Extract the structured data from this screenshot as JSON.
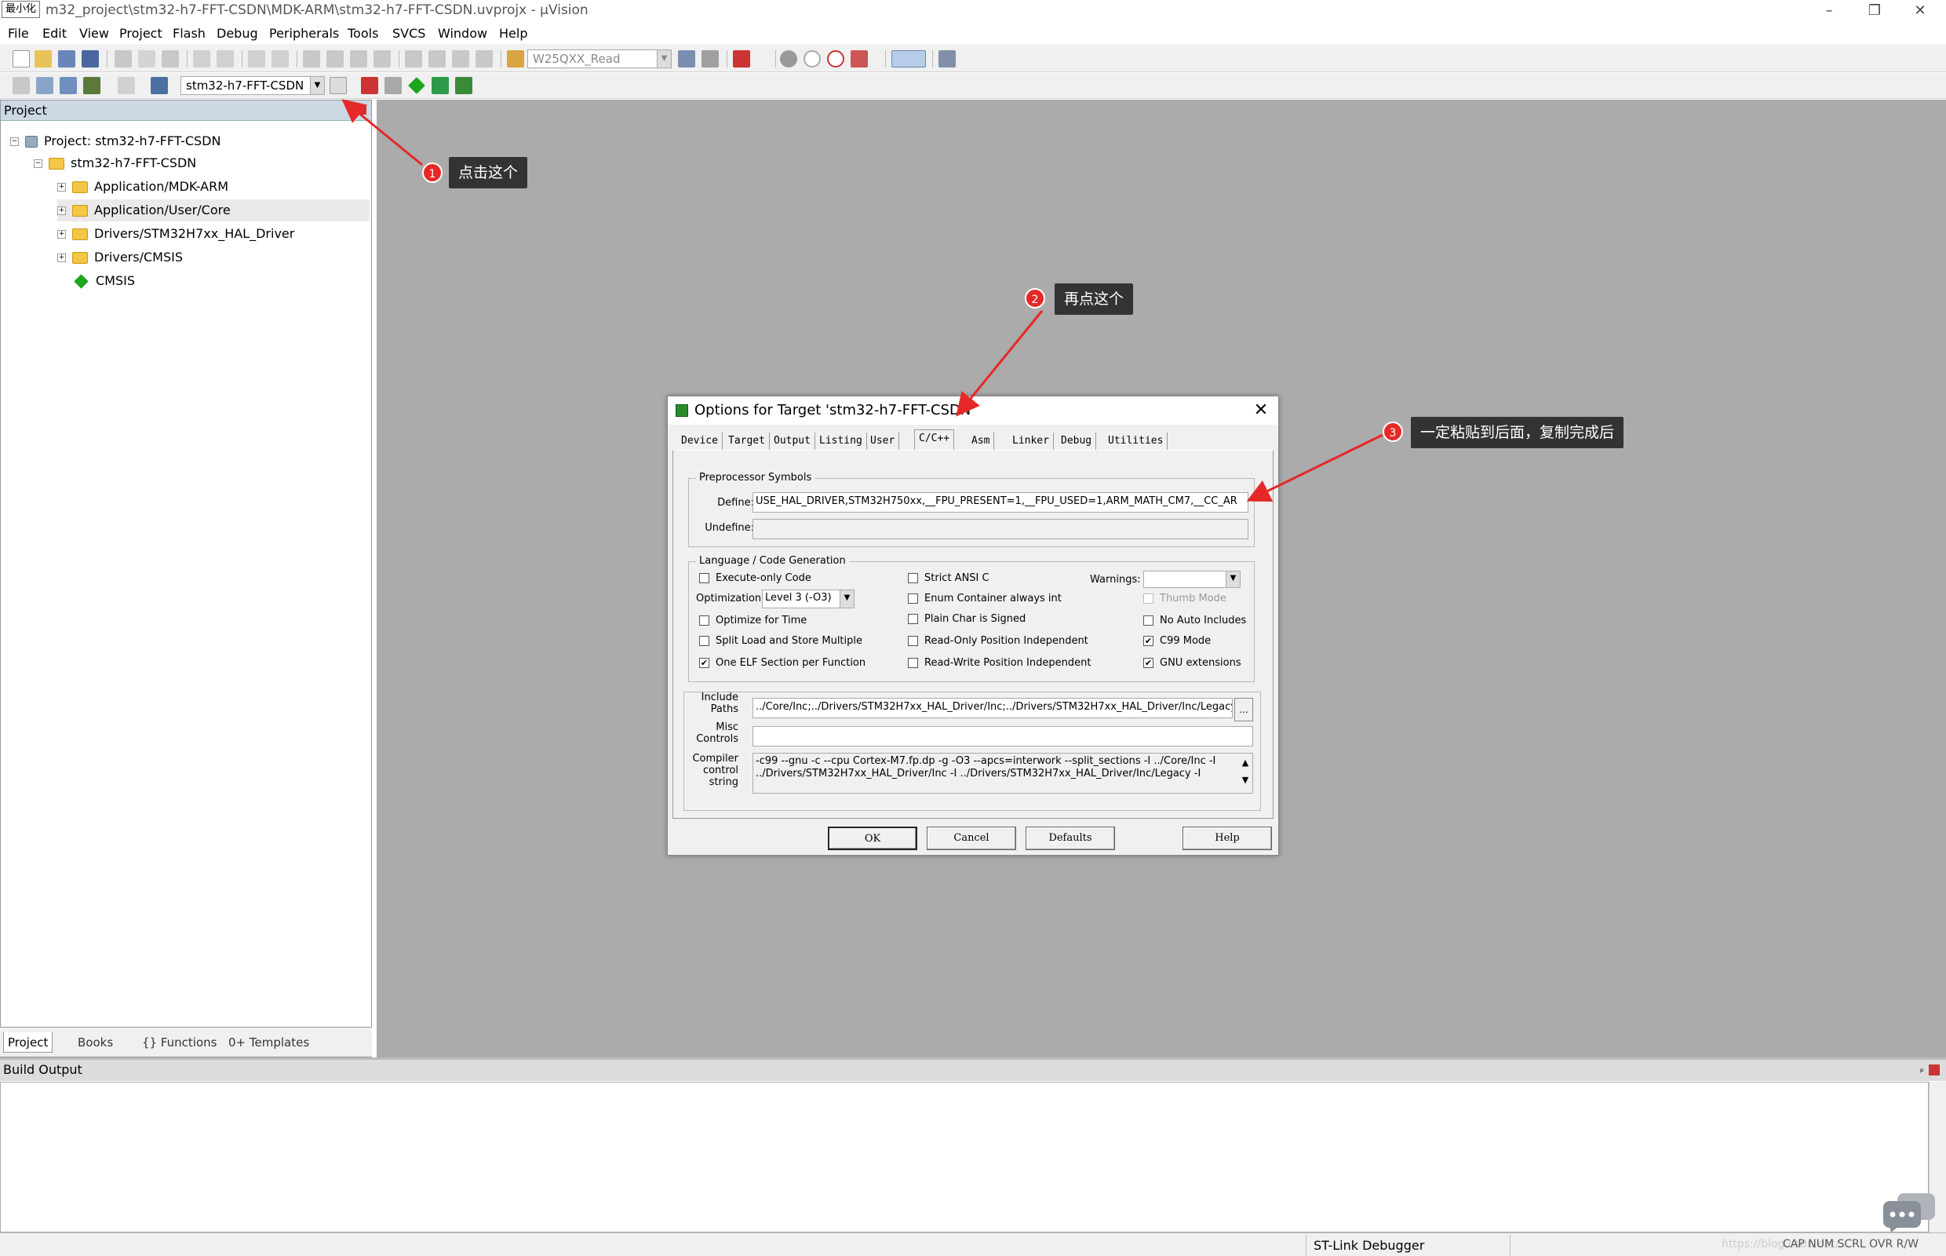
{
  "window": {
    "minimize_tooltip": "最小化",
    "title": "m32_project\\stm32-h7-FFT-CSDN\\MDK-ARM\\stm32-h7-FFT-CSDN.uvprojx - µVision",
    "controls": [
      "–",
      "❐",
      "✕"
    ]
  },
  "menu": [
    "File",
    "Edit",
    "View",
    "Project",
    "Flash",
    "Debug",
    "Peripherals",
    "Tools",
    "SVCS",
    "Window",
    "Help"
  ],
  "toolbar": {
    "find_combo": "W25QXX_Read",
    "target_combo": "stm32-h7-FFT-CSDN"
  },
  "project_panel": {
    "header": "Project",
    "pin": "ᵖ",
    "tree": [
      {
        "label": "Project: stm32-h7-FFT-CSDN",
        "kind": "root"
      },
      {
        "label": "stm32-h7-FFT-CSDN",
        "kind": "target"
      },
      {
        "label": "Application/MDK-ARM",
        "kind": "folder"
      },
      {
        "label": "Application/User/Core",
        "kind": "folder"
      },
      {
        "label": "Drivers/STM32H7xx_HAL_Driver",
        "kind": "folder"
      },
      {
        "label": "Drivers/CMSIS",
        "kind": "folder"
      },
      {
        "label": "CMSIS",
        "kind": "component"
      }
    ],
    "tabs": [
      "Project",
      "Books",
      "{} Functions",
      "0+ Templates"
    ]
  },
  "dialog": {
    "title": "Options for Target 'stm32-h7-FFT-CSDN'",
    "tabs": [
      "Device",
      "Target",
      "Output",
      "Listing",
      "User",
      "C/C++",
      "Asm",
      "Linker",
      "Debug",
      "Utilities"
    ],
    "active_tab": "C/C++",
    "preprocessor": {
      "group_label": "Preprocessor Symbols",
      "define_label": "Define:",
      "define_value": "USE_HAL_DRIVER,STM32H750xx,__FPU_PRESENT=1,__FPU_USED=1,ARM_MATH_CM7,__CC_AR",
      "undefine_label": "Undefine:",
      "undefine_value": ""
    },
    "language": {
      "group_label": "Language / Code Generation",
      "col1": [
        {
          "label": "Execute-only Code",
          "checked": false
        },
        {
          "label": "Optimize for Time",
          "checked": false
        },
        {
          "label": "Split Load and Store Multiple",
          "checked": false
        },
        {
          "label": "One ELF Section per Function",
          "checked": true
        }
      ],
      "optimization_label": "Optimization:",
      "optimization_value": "Level 3 (-O3)",
      "col2": [
        {
          "label": "Strict ANSI C",
          "checked": false
        },
        {
          "label": "Enum Container always int",
          "checked": false
        },
        {
          "label": "Plain Char is Signed",
          "checked": false
        },
        {
          "label": "Read-Only Position Independent",
          "checked": false
        },
        {
          "label": "Read-Write Position Independent",
          "checked": false
        }
      ],
      "warnings_label": "Warnings:",
      "warnings_value": "",
      "col3": [
        {
          "label": "Thumb Mode",
          "checked": false,
          "disabled": true
        },
        {
          "label": "No Auto Includes",
          "checked": false,
          "disabled": false
        },
        {
          "label": "C99 Mode",
          "checked": true,
          "disabled": false
        },
        {
          "label": "GNU extensions",
          "checked": true,
          "disabled": false
        }
      ]
    },
    "include_label_1": "Include",
    "include_label_2": "Paths",
    "include_value": "../Core/Inc;../Drivers/STM32H7xx_HAL_Driver/Inc;../Drivers/STM32H7xx_HAL_Driver/Inc/Legacy",
    "browse": "...",
    "misc_label_1": "Misc",
    "misc_label_2": "Controls",
    "misc_value": "",
    "compiler_label_1": "Compiler",
    "compiler_label_2": "control",
    "compiler_label_3": "string",
    "compiler_line_1": "-c99 --gnu -c --cpu Cortex-M7.fp.dp -g -O3 --apcs=interwork --split_sections -I ../Core/Inc -I",
    "compiler_line_2": "../Drivers/STM32H7xx_HAL_Driver/Inc -I ../Drivers/STM32H7xx_HAL_Driver/Inc/Legacy -I",
    "buttons": {
      "ok": "OK",
      "cancel": "Cancel",
      "defaults": "Defaults",
      "help": "Help"
    }
  },
  "annotations": [
    {
      "num": "1",
      "text": "点击这个"
    },
    {
      "num": "2",
      "text": "再点这个"
    },
    {
      "num": "3",
      "text": "一定粘贴到后面，复制完成后"
    }
  ],
  "build_output": {
    "header": "Build Output"
  },
  "statusbar": {
    "debugger": "ST-Link Debugger",
    "watermark": "https://blog.csdn.net/...",
    "indicators": "CAP  NUM  SCRL  OVR  R/W"
  },
  "colors": {
    "workspace": "#ababab",
    "callout_bg": "#333333",
    "badge": "#e62828",
    "arrow": "#e62828"
  }
}
